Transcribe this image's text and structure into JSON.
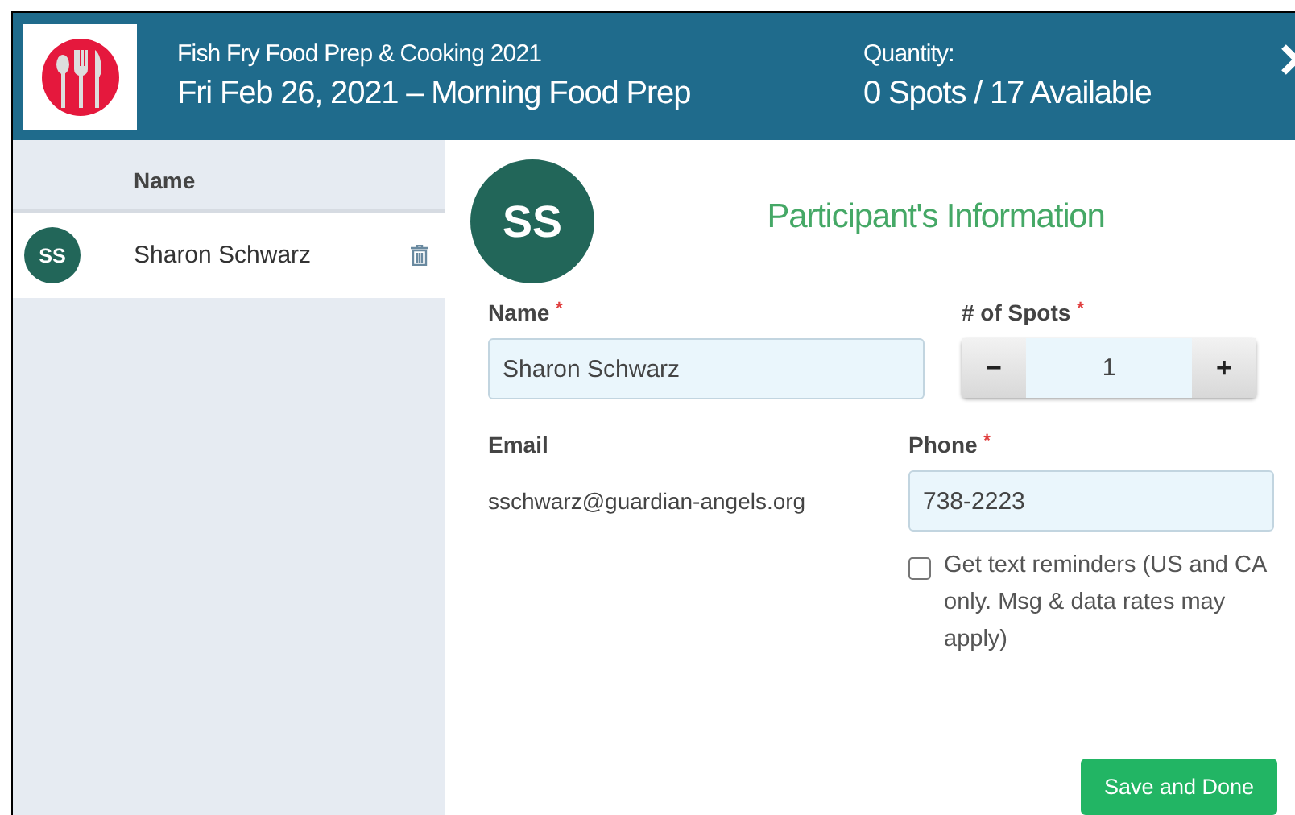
{
  "header": {
    "event": "Fish Fry Food Prep & Cooking 2021",
    "slot": "Fri Feb 26, 2021 – Morning Food Prep",
    "quantity_label": "Quantity:",
    "quantity": "0 Spots / 17 Available"
  },
  "participants": {
    "column": "Name",
    "rows": [
      {
        "initials": "SS",
        "name": "Sharon Schwarz",
        "selected": true
      }
    ]
  },
  "details": {
    "initials": "SS",
    "title": "Participant's Information",
    "name": {
      "label": "Name",
      "required_mark": "*",
      "value": "Sharon Schwarz"
    },
    "spots": {
      "label": "# of Spots",
      "required_mark": "*",
      "value": "1",
      "minus": "−",
      "plus": "+"
    },
    "email": {
      "label": "Email",
      "value": "sschwarz@guardian-angels.org"
    },
    "phone": {
      "label": "Phone",
      "required_mark": "*",
      "value": "738-2223"
    },
    "reminders": {
      "label": "Get text reminders (US and CA only. Msg & data rates may apply)",
      "checked": false
    },
    "save": "Save and Done"
  }
}
